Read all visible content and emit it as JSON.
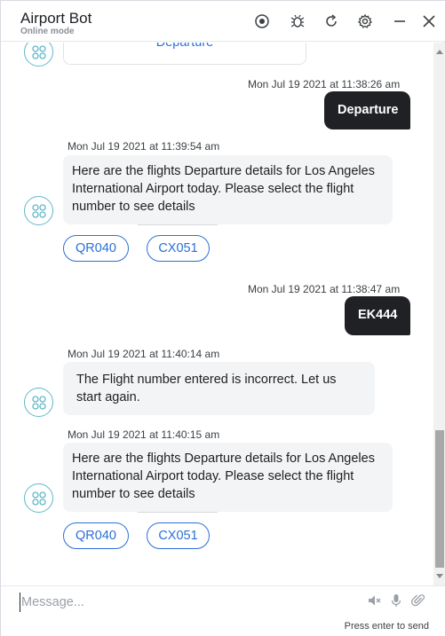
{
  "header": {
    "title": "Airport Bot",
    "mode": "Online mode",
    "icons": [
      "record-icon",
      "bug-icon",
      "refresh-icon",
      "settings-icon",
      "minimize-icon",
      "close-icon"
    ]
  },
  "messages": {
    "card_top_label": "Departure",
    "msg1": {
      "timestamp": "Mon Jul 19 2021 at 11:38:26 am",
      "text": "Departure"
    },
    "msg2": {
      "timestamp": "Mon Jul 19 2021 at 11:39:54 am",
      "text": "Here are the flights Departure details for Los Angeles International Airport today. Please select the flight number to see details",
      "chips": [
        "QR040",
        "CX051"
      ]
    },
    "msg3": {
      "timestamp": "Mon Jul 19 2021 at 11:38:47 am",
      "text": "EK444"
    },
    "msg4": {
      "timestamp": "Mon Jul 19 2021 at 11:40:14 am",
      "text": "The Flight number entered is incorrect. Let us start again."
    },
    "msg5": {
      "timestamp": "Mon Jul 19 2021 at 11:40:15 am",
      "text": "Here are the flights Departure details for Los Angeles International Airport today. Please select the flight number to see details",
      "chips": [
        "QR040",
        "CX051"
      ]
    }
  },
  "composer": {
    "placeholder": "Message...",
    "hint": "Press enter to send",
    "icons": [
      "speaker-mute-icon",
      "microphone-icon",
      "attachment-icon"
    ]
  },
  "colors": {
    "accent": "#2b6fd6",
    "user_bubble": "#202124",
    "bot_bubble": "#f3f4f6",
    "avatar_ring": "#5fb8c9"
  }
}
